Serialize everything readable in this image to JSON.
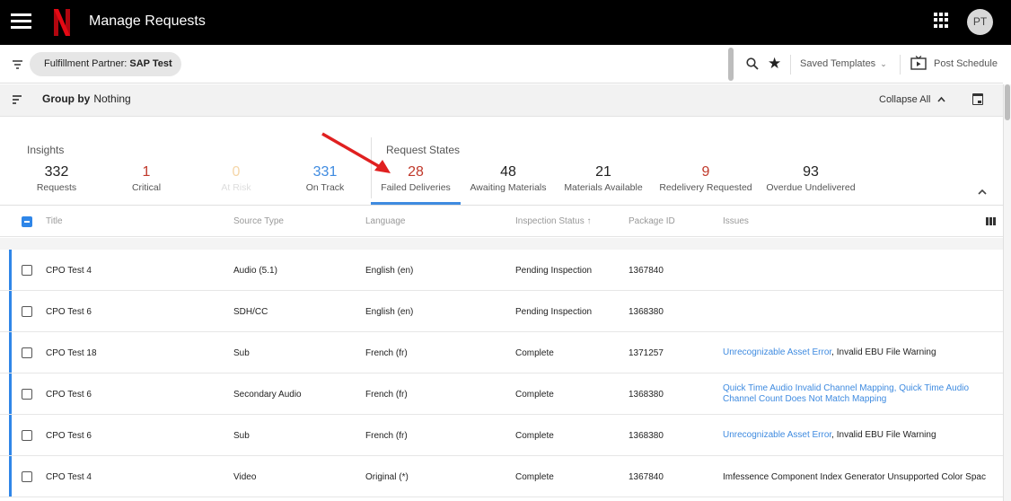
{
  "app": {
    "title": "Manage Requests",
    "avatar_initials": "PT",
    "brand_color": "#e50914"
  },
  "filter": {
    "chip_label": "Fulfillment Partner:",
    "chip_value": "SAP Test",
    "saved_templates": "Saved Templates",
    "post_schedule": "Post Schedule"
  },
  "group": {
    "label": "Group by",
    "value": "Nothing",
    "collapse_all": "Collapse All"
  },
  "insights": {
    "title": "Insights",
    "stats": [
      {
        "value": "332",
        "label": "Requests",
        "color": "#222222"
      },
      {
        "value": "1",
        "label": "Critical",
        "color": "#c0392b"
      },
      {
        "value": "0",
        "label": "At Risk",
        "color": "#f5d6a8"
      },
      {
        "value": "331",
        "label": "On Track",
        "color": "#3f8be0"
      }
    ]
  },
  "request_states": {
    "title": "Request States",
    "stats": [
      {
        "value": "28",
        "label": "Failed Deliveries",
        "color": "#c0392b"
      },
      {
        "value": "48",
        "label": "Awaiting Materials",
        "color": "#222222"
      },
      {
        "value": "21",
        "label": "Materials Available",
        "color": "#222222"
      },
      {
        "value": "9",
        "label": "Redelivery Requested",
        "color": "#c0392b"
      },
      {
        "value": "93",
        "label": "Overdue Undelivered",
        "color": "#222222"
      }
    ]
  },
  "table": {
    "columns": [
      "Title",
      "Source Type",
      "Language",
      "Inspection Status ↑",
      "Package ID",
      "Issues"
    ],
    "rows": [
      {
        "title": "CPO Test 4",
        "source": "Audio (5.1)",
        "language": "English (en)",
        "status": "Pending Inspection",
        "package": "1367840",
        "issue_link": "",
        "issue_text": ""
      },
      {
        "title": "CPO Test 6",
        "source": "SDH/CC",
        "language": "English (en)",
        "status": "Pending Inspection",
        "package": "1368380",
        "issue_link": "",
        "issue_text": ""
      },
      {
        "title": "CPO Test 18",
        "source": "Sub",
        "language": "French (fr)",
        "status": "Complete",
        "package": "1371257",
        "issue_link": "Unrecognizable Asset Error",
        "issue_text": ", Invalid EBU File Warning"
      },
      {
        "title": "CPO Test 6",
        "source": "Secondary Audio",
        "language": "French (fr)",
        "status": "Complete",
        "package": "1368380",
        "issue_link": "Quick Time Audio Invalid Channel Mapping, Quick Time Audio Channel Count Does Not Match Mapping",
        "issue_text": ""
      },
      {
        "title": "CPO Test 6",
        "source": "Sub",
        "language": "French (fr)",
        "status": "Complete",
        "package": "1368380",
        "issue_link": "Unrecognizable Asset Error",
        "issue_text": ", Invalid EBU File Warning"
      },
      {
        "title": "CPO Test 4",
        "source": "Video",
        "language": "Original (*)",
        "status": "Complete",
        "package": "1367840",
        "issue_link": "",
        "issue_text": "Imfessence Component Index Generator Unsupported Color Spac"
      }
    ]
  },
  "icons": [
    "menu-icon",
    "netflix-logo",
    "apps-grid-icon",
    "filter-icon",
    "search-icon",
    "star-icon",
    "post-schedule-icon",
    "sort-icon",
    "calendar-icon",
    "chevron-up-icon",
    "columns-icon",
    "red-arrow-annotation"
  ]
}
